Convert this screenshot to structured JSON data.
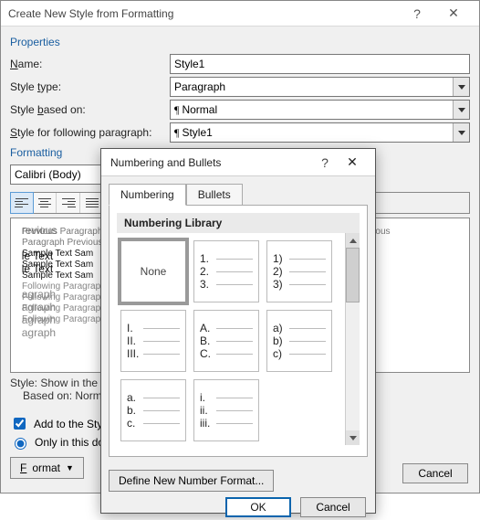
{
  "back": {
    "title": "Create New Style from Formatting",
    "properties_head": "Properties",
    "name_lbl_pre": "",
    "name_lbl_ul": "N",
    "name_lbl_post": "ame:",
    "name_value": "Style1",
    "type_lbl_pre": "Style ",
    "type_lbl_ul": "t",
    "type_lbl_post": "ype:",
    "type_value": "Paragraph",
    "based_lbl_pre": "Style ",
    "based_lbl_ul": "b",
    "based_lbl_post": "ased on:",
    "based_value": "Normal",
    "following_lbl_pre": "",
    "following_lbl_ul": "S",
    "following_lbl_post": "tyle for following paragraph:",
    "following_value": "Style1",
    "formatting_head": "Formatting",
    "font_name": "Calibri (Body)",
    "preview": {
      "prev1": "Previous Paragraph Previous Paragraph Previous Paragraph Previous Paragraph Previous",
      "prev2": "Paragraph Previous",
      "sample1": "Sample Text Sam",
      "sample2": "Sample Text Sam",
      "sample3": "Sample Text Sam",
      "sample_r1": "le Text",
      "sample_r2": "le Text",
      "fol1": "Following Paragraph",
      "fol2": "Following Paragraph",
      "fol3": "Following Paragraph",
      "fol4": "Following Paragraph",
      "fol_r": "agraph"
    },
    "desc1": "Style: Show in the",
    "desc2": "Based on: Norm",
    "add_label": "Add to the Style",
    "only_label": "Only in this doc",
    "format_btn": "Format",
    "cancel": "Cancel"
  },
  "front": {
    "title": "Numbering and Bullets",
    "help": "?",
    "close": "✕",
    "tab_numbering": "Numbering",
    "tab_bullets": "Bullets",
    "lib_head": "Numbering Library",
    "none": "None",
    "tiles": {
      "t1": [
        "1.",
        "2.",
        "3."
      ],
      "t2": [
        "1)",
        "2)",
        "3)"
      ],
      "t3": [
        "I.",
        "II.",
        "III."
      ],
      "t4": [
        "A.",
        "B.",
        "C."
      ],
      "t5": [
        "a)",
        "b)",
        "c)"
      ],
      "t6": [
        "a.",
        "b.",
        "c."
      ],
      "t7": [
        "i.",
        "ii.",
        "iii."
      ]
    },
    "define": "Define New Number Format...",
    "ok": "OK",
    "cancel": "Cancel"
  }
}
